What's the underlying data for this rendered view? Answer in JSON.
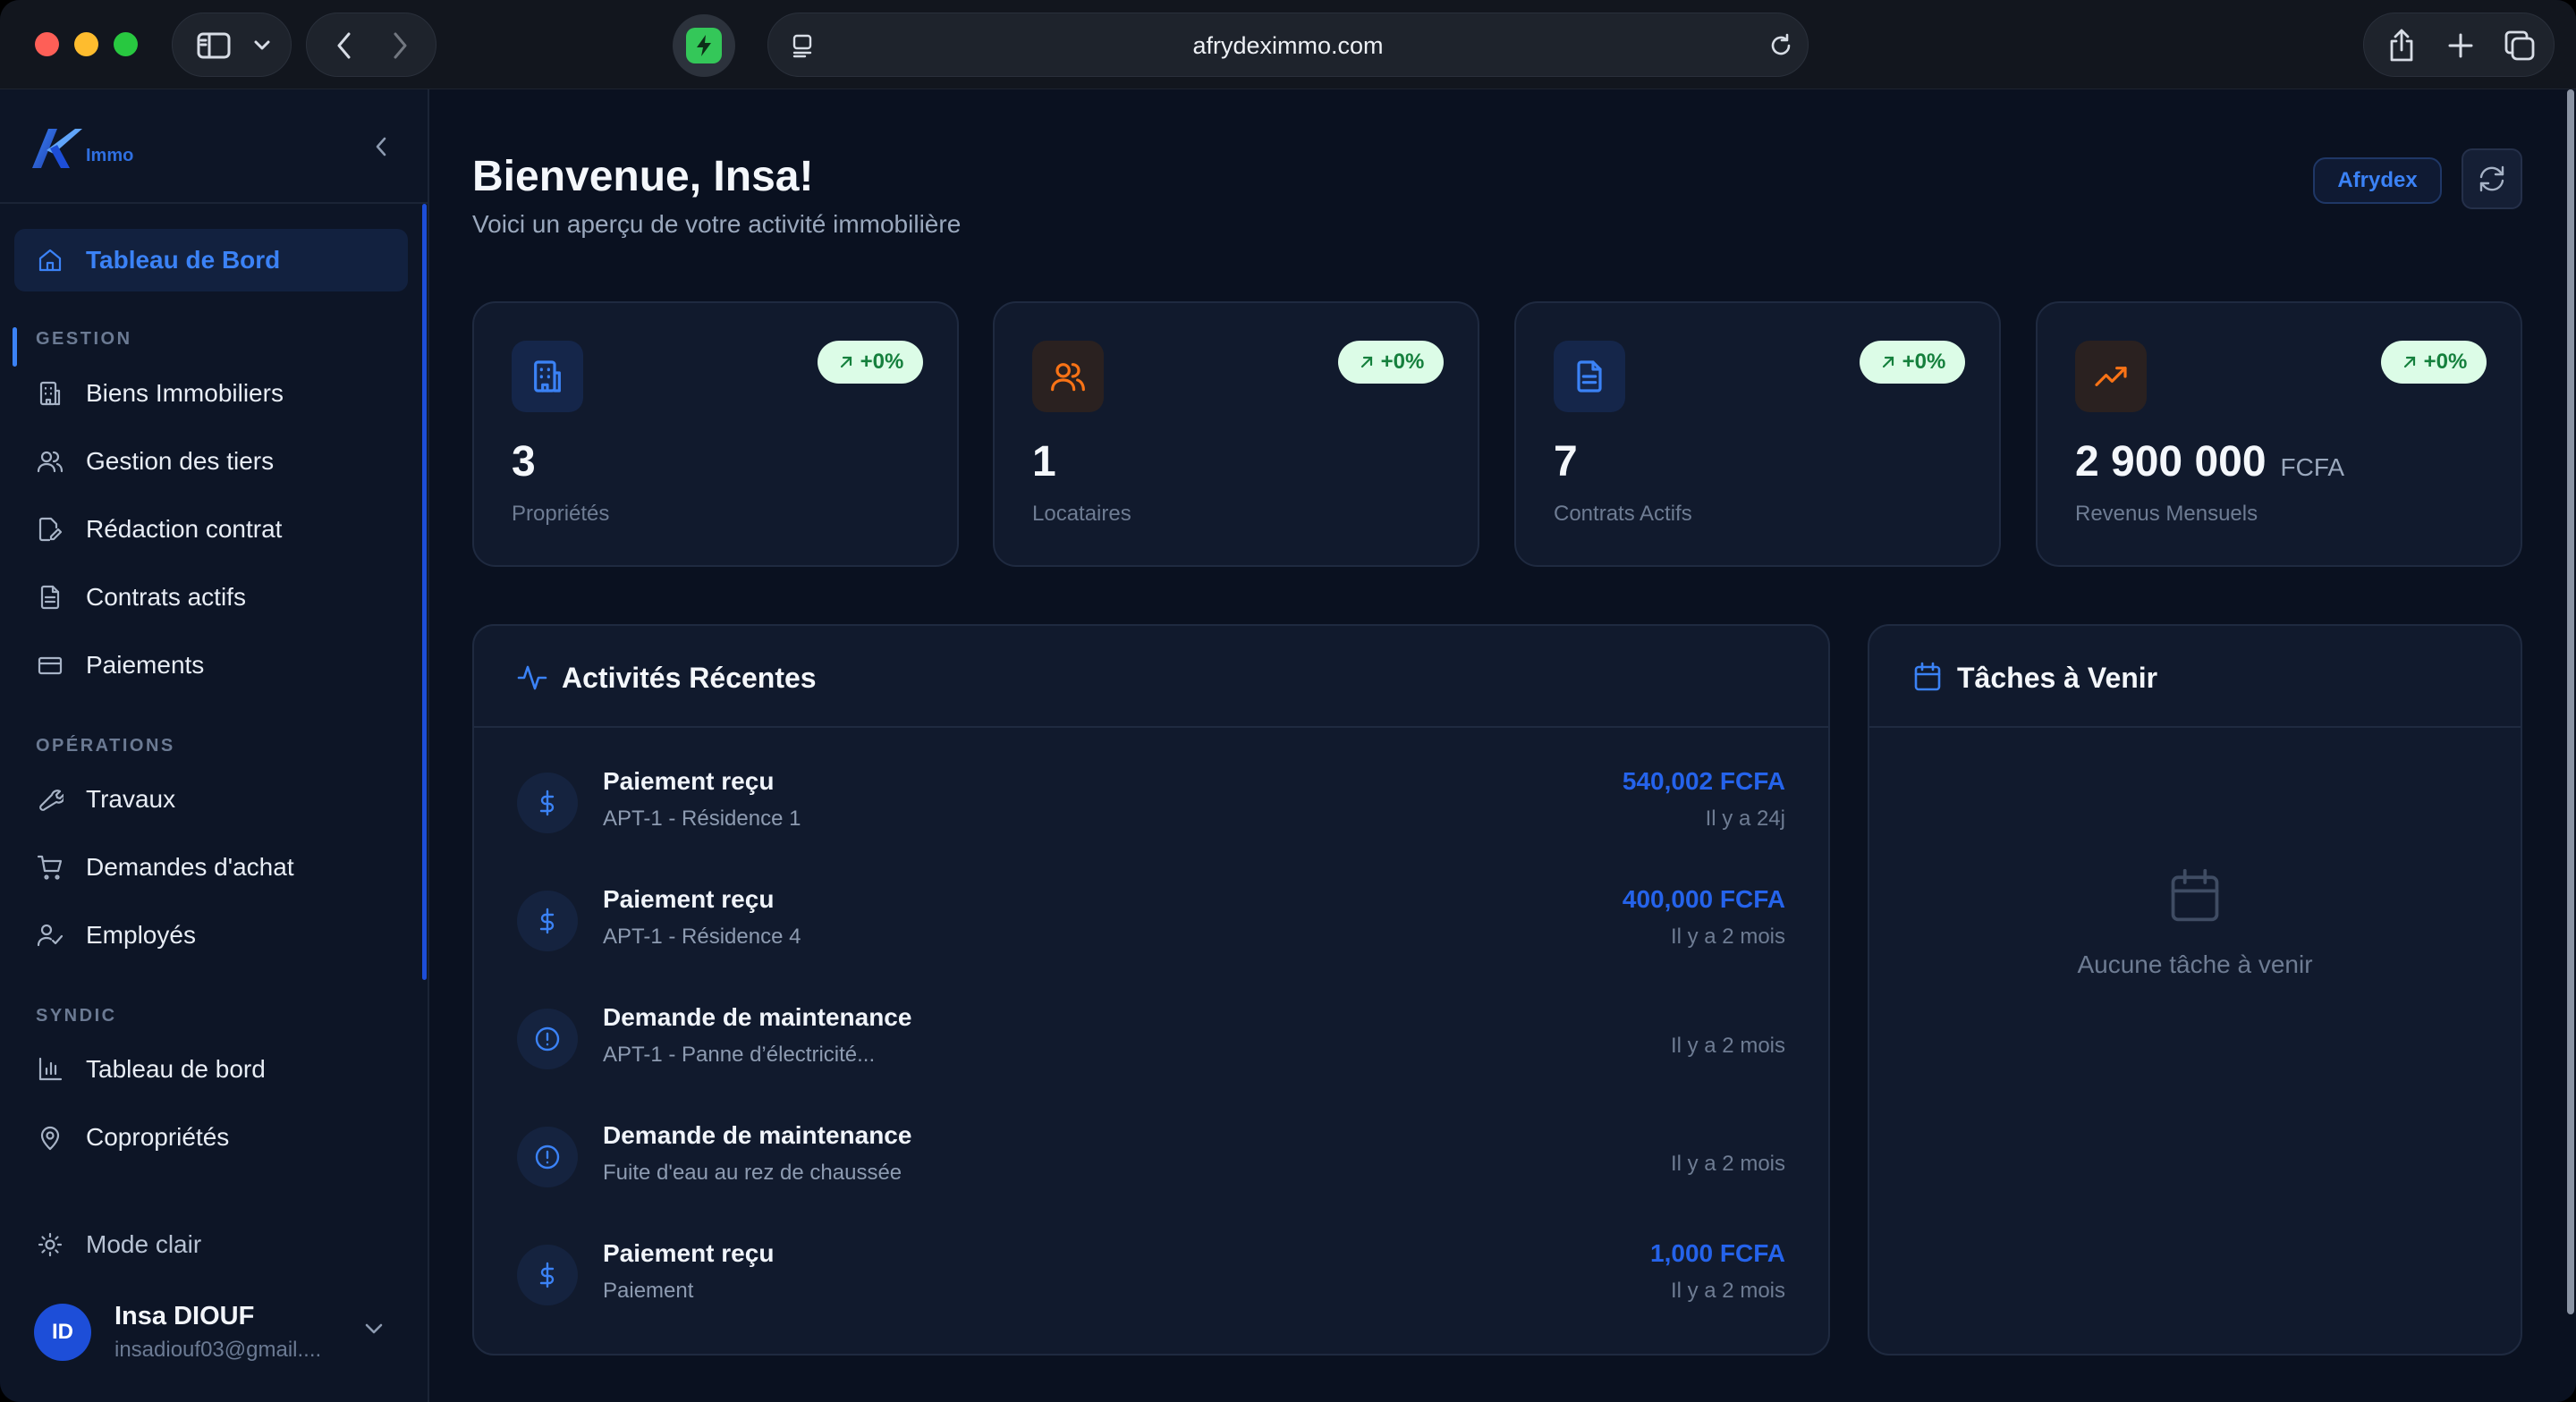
{
  "browser": {
    "url": "afrydeximmo.com"
  },
  "sidebar": {
    "logo_text": "Immo",
    "active": {
      "label": "Tableau de Bord",
      "icon": "home-icon"
    },
    "sections": [
      {
        "label": "GESTION"
      },
      {
        "label": "OPÉRATIONS"
      },
      {
        "label": "SYNDIC"
      }
    ],
    "items": [
      {
        "label": "Biens Immobiliers",
        "icon": "building-icon"
      },
      {
        "label": "Gestion des tiers",
        "icon": "users-icon"
      },
      {
        "label": "Rédaction contrat",
        "icon": "edit-document-icon"
      },
      {
        "label": "Contrats actifs",
        "icon": "document-icon"
      },
      {
        "label": "Paiements",
        "icon": "credit-card-icon"
      },
      {
        "label": "Travaux",
        "icon": "wrench-icon"
      },
      {
        "label": "Demandes d'achat",
        "icon": "cart-icon"
      },
      {
        "label": "Employés",
        "icon": "user-check-icon"
      },
      {
        "label": "Tableau de bord",
        "icon": "bar-chart-icon"
      },
      {
        "label": "Copropriétés",
        "icon": "map-pin-icon"
      }
    ],
    "theme_toggle": "Mode clair",
    "user": {
      "initials": "ID",
      "name": "Insa DIOUF",
      "email": "insadiouf03@gmail...."
    }
  },
  "header": {
    "title": "Bienvenue, Insa!",
    "subtitle": "Voici un aperçu de votre activité immobilière",
    "org_badge": "Afrydex"
  },
  "stats": [
    {
      "value": "3",
      "unit": "",
      "label": "Propriétés",
      "change": "+0%",
      "icon": "building-icon",
      "color": "#3b82f6"
    },
    {
      "value": "1",
      "unit": "",
      "label": "Locataires",
      "change": "+0%",
      "icon": "users-icon",
      "color": "#f97316"
    },
    {
      "value": "7",
      "unit": "",
      "label": "Contrats Actifs",
      "change": "+0%",
      "icon": "document-icon",
      "color": "#3b82f6"
    },
    {
      "value": "2 900 000",
      "unit": "FCFA",
      "label": "Revenus Mensuels",
      "change": "+0%",
      "icon": "trending-up-icon",
      "color": "#f97316"
    }
  ],
  "activities": {
    "title": "Activités Récentes",
    "items": [
      {
        "title": "Paiement reçu",
        "subtitle": "APT-1 - Résidence 1",
        "amount": "540,002 FCFA",
        "time": "Il y a 24j",
        "type": "payment"
      },
      {
        "title": "Paiement reçu",
        "subtitle": "APT-1 - Résidence 4",
        "amount": "400,000 FCFA",
        "time": "Il y a 2 mois",
        "type": "payment"
      },
      {
        "title": "Demande de maintenance",
        "subtitle": "APT-1 - Panne d’électricité...",
        "amount": "",
        "time": "Il y a 2 mois",
        "type": "maintenance"
      },
      {
        "title": "Demande de maintenance",
        "subtitle": "Fuite d'eau au rez de chaussée",
        "amount": "",
        "time": "Il y a 2 mois",
        "type": "maintenance"
      },
      {
        "title": "Paiement reçu",
        "subtitle": "Paiement",
        "amount": "1,000 FCFA",
        "time": "Il y a 2 mois",
        "type": "payment"
      }
    ]
  },
  "tasks": {
    "title": "Tâches à Venir",
    "empty_text": "Aucune tâche à venir"
  },
  "colors": {
    "accent": "#3b82f6",
    "positive_badge_bg": "#dcfce7",
    "positive_badge_text": "#15803d"
  }
}
